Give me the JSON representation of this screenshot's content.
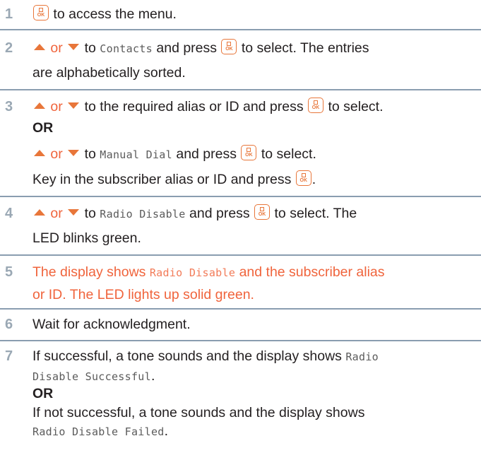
{
  "key_icons": {
    "ok": "OK",
    "menu_ok_key": "menu-ok-key-icon",
    "up": "up-arrow-icon",
    "down": "down-arrow-icon"
  },
  "colors": {
    "accent": "#e8763a",
    "highlight_text": "#f0643c",
    "step_number": "#9aa8b4",
    "divider": "#8a9db0"
  },
  "steps": [
    {
      "num": "1",
      "text": "to access the menu."
    },
    {
      "num": "2",
      "or": "or",
      "to": "to",
      "menu_item": "Contacts",
      "press": "and press",
      "select": "to select. The entries",
      "line2": "are alphabetically sorted."
    },
    {
      "num": "3",
      "or": "or",
      "a1": "to the required alias or ID and press",
      "a2": "to select.",
      "or_bold": "OR",
      "to": "to",
      "menu_item": "Manual Dial",
      "press": "and press",
      "select": "to select.",
      "line4": "Key in the subscriber alias or ID and press",
      "period": "."
    },
    {
      "num": "4",
      "or": "or",
      "to": "to",
      "menu_item": "Radio Disable",
      "press": "and press",
      "select": "to select. The",
      "line2": "LED blinks green."
    },
    {
      "num": "5",
      "a": "The display shows",
      "menu_item": "Radio Disable",
      "b": "and the subscriber alias",
      "line2": "or ID. The LED lights up solid green."
    },
    {
      "num": "6",
      "text": "Wait for acknowledgment."
    },
    {
      "num": "7",
      "a": "If successful, a tone sounds and the display shows",
      "m1": "Radio",
      "m2": "Disable Successful",
      "period": ".",
      "or_bold": "OR",
      "c": "If not successful, a tone sounds and the display shows",
      "m3": "Radio Disable Failed",
      "period2": "."
    }
  ]
}
